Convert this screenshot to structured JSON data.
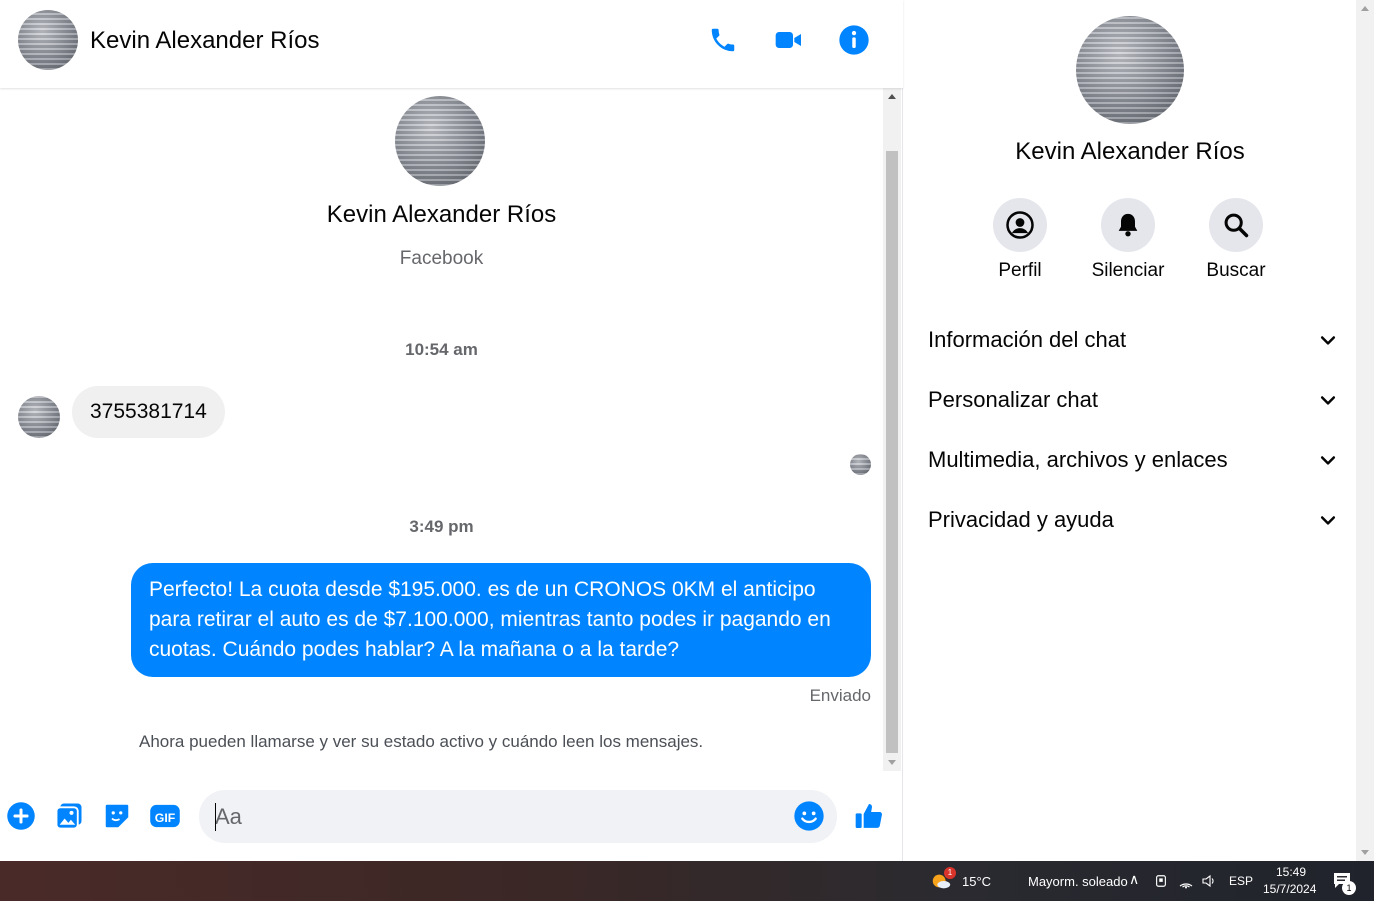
{
  "contact": {
    "name": "Kevin Alexander Ríos",
    "source": "Facebook"
  },
  "colors": {
    "accent": "#0084ff",
    "bubble_in": "#f0f0f0",
    "muted": "#65676b"
  },
  "header": {
    "icons": [
      "phone-icon",
      "video-camera-icon",
      "info-icon"
    ]
  },
  "conversation": {
    "time_1": "10:54 am",
    "incoming_message": "3755381714",
    "time_2": "3:49 pm",
    "outgoing_message": "Perfecto! La cuota desde $195.000. es de un CRONOS 0KM el anticipo para retirar el auto es de $7.100.000, mientras tanto podes ir pagando en cuotas. Cuándo podes hablar? A la mañana o a la tarde?",
    "sent_status": "Enviado",
    "notice": "Ahora pueden llamarse y ver su estado activo y cuándo leen los mensajes."
  },
  "composer": {
    "placeholder": "Aa",
    "icons": [
      "plus-circle-icon",
      "image-icon",
      "sticker-icon",
      "gif-icon",
      "emoji-icon",
      "thumbs-up-icon"
    ]
  },
  "side_panel": {
    "actions": [
      {
        "label": "Perfil",
        "icon": "profile-icon"
      },
      {
        "label": "Silenciar",
        "icon": "bell-icon"
      },
      {
        "label": "Buscar",
        "icon": "search-icon"
      }
    ],
    "sections": [
      {
        "title": "Información del chat"
      },
      {
        "title": "Personalizar chat"
      },
      {
        "title": "Multimedia, archivos y enlaces"
      },
      {
        "title": "Privacidad y ayuda"
      }
    ]
  },
  "taskbar": {
    "weather_temp": "15°C",
    "weather_desc": "Mayorm. soleado",
    "weather_badge": "1",
    "language": "ESP",
    "time": "15:49",
    "date": "15/7/2024",
    "notification_count": "1"
  }
}
